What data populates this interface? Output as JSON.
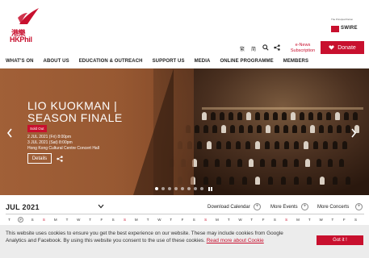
{
  "header": {
    "logo_cn": "港樂",
    "logo_en": "HKPhil",
    "sponsor_label": "The Principal Patron",
    "sponsor_name": "SWIRE",
    "lang_tc": "繁",
    "lang_sc": "简",
    "enews_label": "e-News Subscription",
    "donate_label": "Donate",
    "brand_color": "#c8102e"
  },
  "nav": {
    "items": [
      "WHAT'S ON",
      "ABOUT US",
      "EDUCATION & OUTREACH",
      "SUPPORT US",
      "MEDIA",
      "ONLINE PROGRAMME",
      "MEMBERS"
    ]
  },
  "hero": {
    "title_line1": "LIO KUOKMAN |",
    "title_line2": "SEASON FINALE",
    "badge": "Sold Out",
    "date1": "2 JUL 2021 (Fri) 8:00pm",
    "date2": "3 JUL 2021 (Sat) 8:00pm",
    "venue": "Hong Kong Cultural Centre Concert Hall",
    "details_label": "Details",
    "slide_count": 8,
    "active_slide": 0
  },
  "calendar": {
    "month_label": "JUL 2021",
    "download_label": "Download Calendar",
    "more_events_label": "More Events",
    "more_concerts_label": "More Concerts",
    "days": [
      "T",
      "F",
      "S",
      "S",
      "M",
      "T",
      "W",
      "T",
      "F",
      "S",
      "S",
      "M",
      "T",
      "W",
      "T",
      "F",
      "S",
      "S",
      "M",
      "T",
      "W",
      "T",
      "F",
      "S",
      "S",
      "M",
      "T",
      "W",
      "T",
      "F",
      "S"
    ],
    "today_index": 1
  },
  "cookie": {
    "text": "This website uses cookies to ensure you get the best experience on our website. These may include cookies from Google Analytics and Facebook. By using this website you consent to the use of these cookies.",
    "link_label": "Read more about Cookie",
    "button_label": "Got it !"
  }
}
